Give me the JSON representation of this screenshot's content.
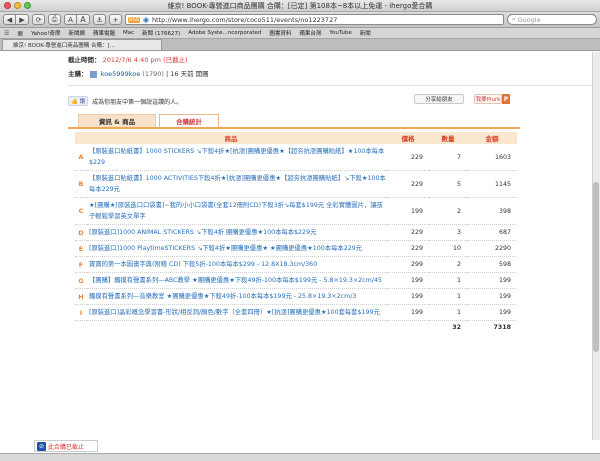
{
  "window": {
    "title": "維京! BOOK-專營進口商品團購 合購：[已定] 第108本~8本以上免運 - ihergo愛合購"
  },
  "toolbar": {
    "back": "◀",
    "forward": "▶",
    "reload": "⟳",
    "print": "⎙",
    "font_small": "A",
    "font_big": "A",
    "bookmark": "⚓",
    "add": "+",
    "url": "http://www.ihergo.com/store/coco511/events/no1223727",
    "search_placeholder": "Google"
  },
  "bookmarks": [
    "Yahoo!奇摩",
    "新聞網",
    "蘋果電腦",
    "Mac",
    "新聞 (176627)",
    "Adobe Syste...ncorporated",
    "圖書資料",
    "蘋果台灣",
    "YouTube",
    "新聞"
  ],
  "tab": {
    "label": "維京! BOOK-專營進口商品團購 合購：[..."
  },
  "event": {
    "deadline_label": "截止時間：",
    "deadline_value": "2012/7/6",
    "deadline_time": "4:40 pm",
    "deadline_status": "(已截止)",
    "host_label": "主購：",
    "host_name": "koe5999koe",
    "host_count": "(1790)",
    "host_time": "| 16 天前 開團"
  },
  "social": {
    "like": "讚",
    "like_text": "成為你朋友中第一個說這讚的人。",
    "share": "分享給朋友",
    "plurk": "我要Plurk",
    "plurk_badge": "P"
  },
  "tabs": [
    {
      "label": "資訊 & 商品",
      "active": false
    },
    {
      "label": "合購統計",
      "active": true
    }
  ],
  "table": {
    "headers": {
      "item": "商品",
      "price": "價格",
      "qty": "數量",
      "amount": "金額"
    },
    "rows": [
      {
        "letter": "A",
        "name": "【原裝進口貼紙書】1000 STICKERS ↘下殺4折★[抗漲]團購更優惠★【超夯抗漲團購貼紙】★100本每本$229",
        "price": "229",
        "qty": "7",
        "amount": "1603"
      },
      {
        "letter": "B",
        "name": "【原裝進口貼紙書】1000 ACTIVITIES下殺4折★[抗漲]團購更優惠★【超夯抗漲團購貼紙】↘下殺★100本每本229元",
        "price": "229",
        "qty": "5",
        "amount": "1145"
      },
      {
        "letter": "C",
        "name": "★[團購★[原裝進口口袋書]~我的小小口袋書(全套12冊附CD)下殺3折↘每套$199元 全彩實體圖片，讓孩子輕鬆學習英文單字",
        "price": "199",
        "qty": "2",
        "amount": "398"
      },
      {
        "letter": "D",
        "name": "[原裝進口]1000 ANIMAL STICKERS ↘下殺4折 團購更優惠★100本每本$229元",
        "price": "229",
        "qty": "3",
        "amount": "687"
      },
      {
        "letter": "E",
        "name": "[原裝進口]1000 PlaytimeSTICKERS ↘下殺4折★團購更優惠★ ★團購更優惠★100本每本229元",
        "price": "229",
        "qty": "10",
        "amount": "2290"
      },
      {
        "letter": "F",
        "name": "寶寶的第一本圖畫字典(附贈 CD) 下殺5折-100本每本$299 - 12.8X18.3cm/360",
        "price": "299",
        "qty": "2",
        "amount": "598"
      },
      {
        "letter": "G",
        "name": "【團購】觸摸有聲書系列—ABC教學 ★團購更優惠★下殺49折-100本每本$199元 - 5.8×19.3×2cm/45",
        "price": "199",
        "qty": "1",
        "amount": "199"
      },
      {
        "letter": "H",
        "name": "觸摸有聲書系列—音樂教室 ★團購更優惠★下殺49折-100本每本$199元 - 25.8×19.3×2cm/3",
        "price": "199",
        "qty": "1",
        "amount": "199"
      },
      {
        "letter": "I",
        "name": "[原裝進口]晶彩概念學習書-形狀/相反詞/顏色/數字（全套四冊）★[抗漲]團購更優惠★100套每套$199元",
        "price": "199",
        "qty": "1",
        "amount": "199"
      }
    ],
    "total_qty": "32",
    "total_amount": "7318"
  },
  "status": {
    "closed_label": "此合購已截止"
  }
}
